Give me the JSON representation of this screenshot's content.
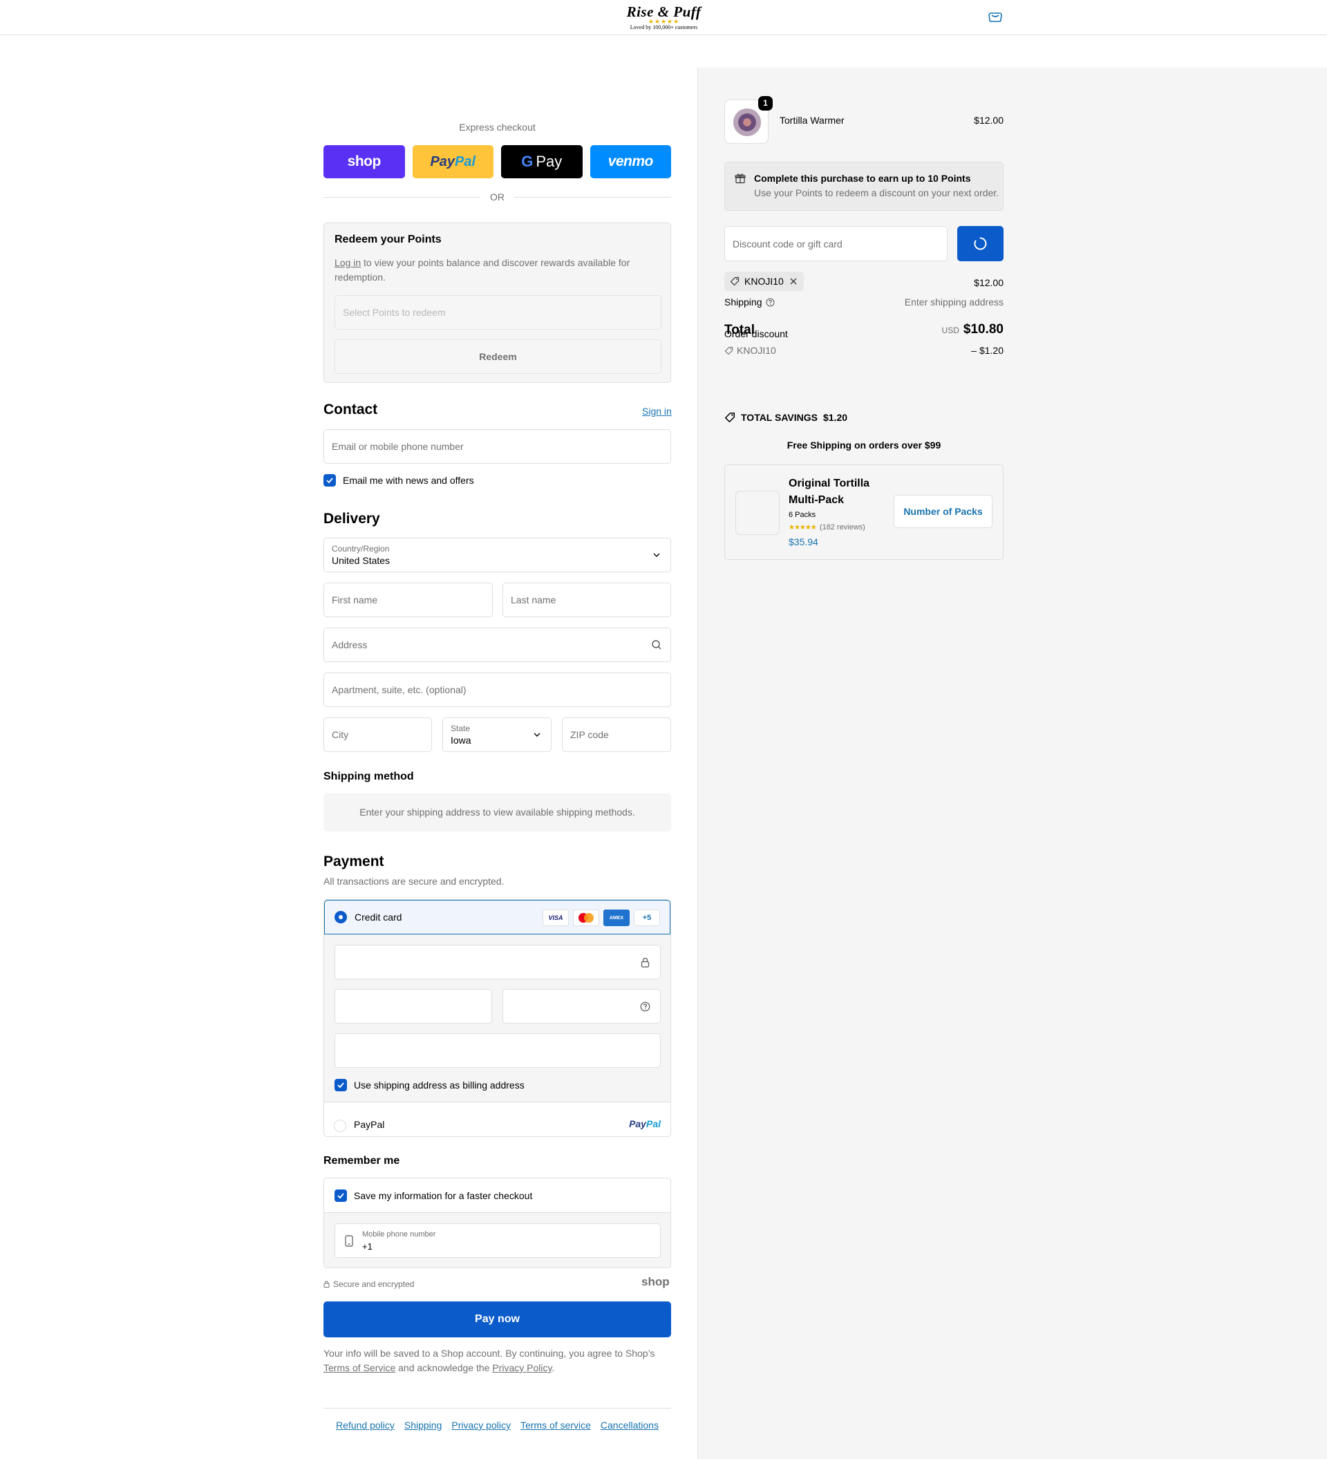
{
  "header": {
    "logo_title": "Rise & Puff",
    "logo_stars": "★★★★★",
    "logo_tagline": "Loved by 100,000+ customers",
    "cart_icon": "cart-icon"
  },
  "express": {
    "label": "Express checkout",
    "buttons": {
      "shop": "shop",
      "paypal_a": "Pay",
      "paypal_b": "Pal",
      "gpay_g": "G",
      "gpay": "Pay",
      "venmo": "venmo"
    },
    "or": "OR"
  },
  "points": {
    "title": "Redeem your Points",
    "login_link": "Log in",
    "desc": " to view your points balance and discover rewards available for redemption.",
    "select_placeholder": "Select Points to redeem",
    "redeem_label": "Redeem"
  },
  "contact": {
    "title": "Contact",
    "signin": "Sign in",
    "email_placeholder": "Email or mobile phone number",
    "news_label": "Email me with news and offers"
  },
  "delivery": {
    "title": "Delivery",
    "country_label": "Country/Region",
    "country_value": "United States",
    "first_name": "First name",
    "last_name": "Last name",
    "address": "Address",
    "apartment": "Apartment, suite, etc. (optional)",
    "city": "City",
    "state_label": "State",
    "state_value": "Iowa",
    "zip": "ZIP code"
  },
  "shipping_method": {
    "title": "Shipping method",
    "info": "Enter your shipping address to view available shipping methods."
  },
  "payment": {
    "title": "Payment",
    "subtitle": "All transactions are secure and encrypted.",
    "credit_card": "Credit card",
    "cards": {
      "visa": "VISA",
      "amex": "AMEX",
      "more": "+5"
    },
    "billing_label": "Use shipping address as billing address",
    "paypal_label": "PayPal",
    "paypal_logo_a": "Pay",
    "paypal_logo_b": "Pal"
  },
  "remember": {
    "title": "Remember me",
    "save_label": "Save my information for a faster checkout",
    "phone_label": "Mobile phone number",
    "phone_value": "+1"
  },
  "footer": {
    "secure": "Secure and encrypted",
    "shop": "shop",
    "pay_now": "Pay now",
    "legal_1": "Your info will be saved to a Shop account. By continuing, you agree to Shop’s ",
    "tos": "Terms of Service",
    "legal_2": " and acknowledge the ",
    "privacy": "Privacy Policy",
    "legal_3": ".",
    "links": [
      "Refund policy",
      "Shipping",
      "Privacy policy",
      "Terms of service",
      "Cancellations"
    ]
  },
  "summary": {
    "item": {
      "name": "Tortilla Warmer",
      "price": "$12.00",
      "qty": "1"
    },
    "earn_title": "Complete this purchase to earn up to 10 Points",
    "earn_sub": "Use your Points to redeem a discount on your next order.",
    "discount_placeholder": "Discount code or gift card",
    "code_chip": "KNOJI10",
    "subtotal_value": "$12.00",
    "shipping_label": "Shipping",
    "shipping_value": "Enter shipping address",
    "total_label": "Total",
    "order_discount_label": "Order discount",
    "currency": "USD",
    "total_value": "$10.80",
    "discount_code": "KNOJI10",
    "discount_value": "– $1.20",
    "savings_label": "TOTAL SAVINGS",
    "savings_value": "$1.20",
    "free_shipping": "Free Shipping on orders over $99",
    "upsell": {
      "name": "Original Tortilla Multi-Pack",
      "packs": "6 Packs",
      "stars": "★★★★★",
      "reviews": "(182 reviews)",
      "price": "$35.94",
      "button": "Number of Packs"
    }
  },
  "colors": {
    "primary": "#0b5cca",
    "link": "#1773b0",
    "shop": "#5a31f4",
    "paypal": "#ffc439",
    "venmo": "#008cff"
  }
}
